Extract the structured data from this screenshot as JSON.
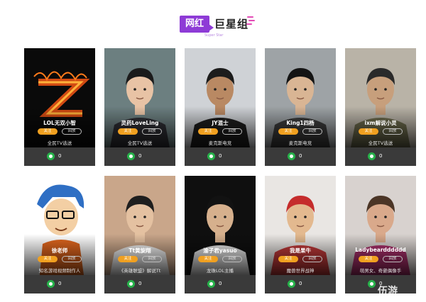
{
  "header": {
    "badge": "网红",
    "title": "巨星组",
    "subtitle": "Super Star"
  },
  "cards": [
    {
      "name": "LOL无双小智",
      "follow": "关注",
      "replay": "回放",
      "desc": "全民TV选送",
      "likes": "0"
    },
    {
      "name": "灵药LoveLing",
      "follow": "关注",
      "replay": "回放",
      "desc": "全民TV选送",
      "likes": "0"
    },
    {
      "name": "JY混士",
      "follow": "关注",
      "replay": "回放",
      "desc": "麦克斯电竞",
      "likes": "0"
    },
    {
      "name": "King1四杨",
      "follow": "关注",
      "replay": "回放",
      "desc": "麦克斯电竞",
      "likes": "0"
    },
    {
      "name": "ixm解说小灵",
      "follow": "关注",
      "replay": "回放",
      "desc": "全民TV选送",
      "likes": "0"
    },
    {
      "name": "徐老师",
      "follow": "关注",
      "replay": "回放",
      "desc": "知名游戏视频制作人",
      "likes": "0"
    },
    {
      "name": "Tt黄旋翔",
      "follow": "关注",
      "replay": "回放",
      "desc": "《英雄联盟》解说Tt",
      "likes": "0"
    },
    {
      "name": "渝子君yasuo",
      "follow": "关注",
      "replay": "回放",
      "desc": "龙珠LOL主播",
      "likes": "0"
    },
    {
      "name": "我是果牛",
      "follow": "关注",
      "replay": "回放",
      "desc": "魔兽世界战神",
      "likes": "0"
    },
    {
      "name": "Ladybeardddddd",
      "follow": "关注",
      "replay": "回放",
      "desc": "萌男女、奇葩偶像手",
      "likes": "0"
    }
  ],
  "watermark": "伍游",
  "colors": {
    "accent": "#8e3bd6",
    "follow": "#f0a020",
    "like": "#27b24a",
    "card": "#333333"
  }
}
